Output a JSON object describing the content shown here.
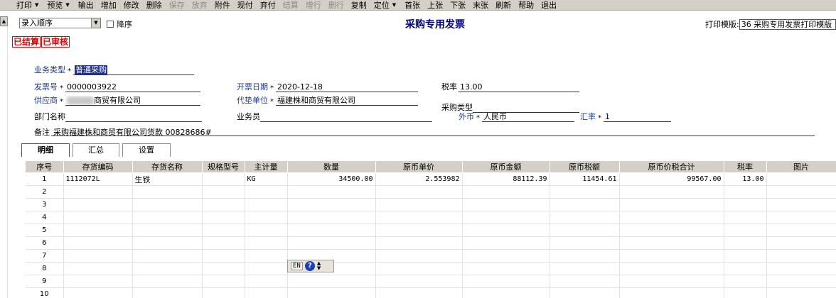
{
  "toolbar": {
    "items": [
      {
        "label": "打印",
        "arrow": true,
        "disabled": false
      },
      {
        "label": "预览",
        "arrow": true,
        "disabled": false
      },
      {
        "label": "输出",
        "arrow": false,
        "disabled": false
      },
      {
        "label": "增加",
        "arrow": false,
        "disabled": false
      },
      {
        "label": "修改",
        "arrow": false,
        "disabled": false
      },
      {
        "label": "删除",
        "arrow": false,
        "disabled": false
      },
      {
        "label": "保存",
        "arrow": false,
        "disabled": true
      },
      {
        "label": "放弃",
        "arrow": false,
        "disabled": true
      },
      {
        "label": "附件",
        "arrow": false,
        "disabled": false
      },
      {
        "label": "现付",
        "arrow": false,
        "disabled": false
      },
      {
        "label": "弃付",
        "arrow": false,
        "disabled": false
      },
      {
        "label": "结算",
        "arrow": false,
        "disabled": true
      },
      {
        "label": "增行",
        "arrow": false,
        "disabled": true
      },
      {
        "label": "删行",
        "arrow": false,
        "disabled": true
      },
      {
        "label": "复制",
        "arrow": false,
        "disabled": false
      },
      {
        "label": "定位",
        "arrow": true,
        "disabled": false
      },
      {
        "label": "首张",
        "arrow": false,
        "disabled": false
      },
      {
        "label": "上张",
        "arrow": false,
        "disabled": false
      },
      {
        "label": "下张",
        "arrow": false,
        "disabled": false
      },
      {
        "label": "末张",
        "arrow": false,
        "disabled": false
      },
      {
        "label": "刷新",
        "arrow": false,
        "disabled": false
      },
      {
        "label": "帮助",
        "arrow": false,
        "disabled": false
      },
      {
        "label": "退出",
        "arrow": false,
        "disabled": false
      }
    ]
  },
  "top": {
    "sort_value": "录入顺序",
    "desc_label": "降序",
    "title": "采购专用发票",
    "print_template_label": "打印模版:",
    "print_template_value": "36 采购专用发票打印模版"
  },
  "stamps": [
    "已结算",
    "已审核"
  ],
  "form": {
    "business_type": {
      "label": "业务类型",
      "value": "普通采购"
    },
    "invoice_no": {
      "label": "发票号",
      "value": "0000003922"
    },
    "invoice_date": {
      "label": "开票日期",
      "value": "2020-12-18"
    },
    "tax_rate": {
      "label": "税率",
      "value": "13.00"
    },
    "supplier": {
      "label": "供应商",
      "value": "商贸有限公司"
    },
    "advance_unit": {
      "label": "代垫单位",
      "value": "福建株和商贸有限公司"
    },
    "purchase_type": {
      "label": "采购类型",
      "value": ""
    },
    "dept": {
      "label": "部门名称",
      "value": ""
    },
    "salesman": {
      "label": "业务员",
      "value": ""
    },
    "currency": {
      "label": "外币",
      "value": "人民币"
    },
    "exchange_rate": {
      "label": "汇率",
      "value": "1"
    },
    "remark": {
      "label": "备注",
      "value": "采购福建株和商贸有限公司货款   00828686#"
    }
  },
  "tabs": [
    "明细",
    "汇总",
    "设置"
  ],
  "grid": {
    "columns": [
      "序号",
      "存货编码",
      "存货名称",
      "规格型号",
      "主计量",
      "数量",
      "原币单价",
      "原币金额",
      "原币税额",
      "原币价税合计",
      "税率",
      "图片"
    ],
    "rows": [
      [
        "1",
        "1112072L",
        "生铁",
        "",
        "KG",
        "34500.00",
        "2.553982",
        "88112.39",
        "11454.61",
        "99567.00",
        "13.00",
        ""
      ],
      [
        "2",
        "",
        "",
        "",
        "",
        "",
        "",
        "",
        "",
        "",
        "",
        ""
      ],
      [
        "3",
        "",
        "",
        "",
        "",
        "",
        "",
        "",
        "",
        "",
        "",
        ""
      ],
      [
        "4",
        "",
        "",
        "",
        "",
        "",
        "",
        "",
        "",
        "",
        "",
        ""
      ],
      [
        "5",
        "",
        "",
        "",
        "",
        "",
        "",
        "",
        "",
        "",
        "",
        ""
      ],
      [
        "6",
        "",
        "",
        "",
        "",
        "",
        "",
        "",
        "",
        "",
        "",
        ""
      ],
      [
        "7",
        "",
        "",
        "",
        "",
        "",
        "",
        "",
        "",
        "",
        "",
        ""
      ],
      [
        "8",
        "",
        "",
        "",
        "",
        "",
        "",
        "",
        "",
        "",
        "",
        ""
      ],
      [
        "9",
        "",
        "",
        "",
        "",
        "",
        "",
        "",
        "",
        "",
        "",
        ""
      ],
      [
        "10",
        "",
        "",
        "",
        "",
        "",
        "",
        "",
        "",
        "",
        "",
        ""
      ]
    ]
  },
  "ime": {
    "mode": "EN",
    "help": "?"
  }
}
